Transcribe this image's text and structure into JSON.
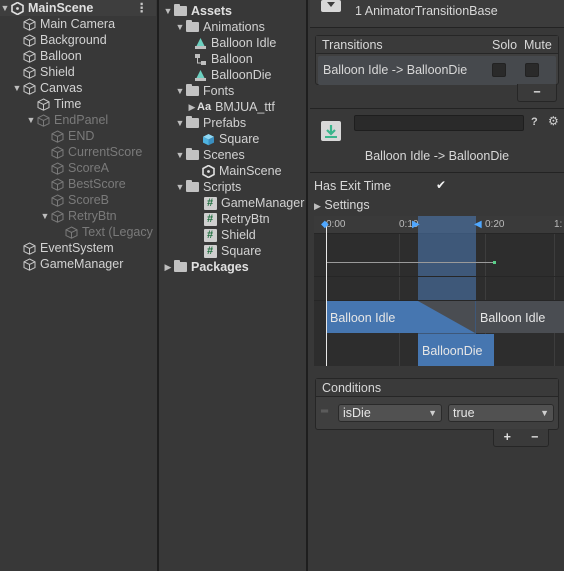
{
  "hierarchy": {
    "scene": "MainScene",
    "menu_glyph": "⋮",
    "items": [
      {
        "label": "Main Camera"
      },
      {
        "label": "Background"
      },
      {
        "label": "Balloon"
      },
      {
        "label": "Shield"
      },
      {
        "label": "Canvas"
      },
      {
        "label": "Time"
      },
      {
        "label": "EndPanel"
      },
      {
        "label": "END"
      },
      {
        "label": "CurrentScore"
      },
      {
        "label": "ScoreA"
      },
      {
        "label": "BestScore"
      },
      {
        "label": "ScoreB"
      },
      {
        "label": "RetryBtn"
      },
      {
        "label": "Text (Legacy"
      },
      {
        "label": "EventSystem"
      },
      {
        "label": "GameManager"
      }
    ]
  },
  "project": {
    "assets": "Assets",
    "animations": "Animations",
    "anim_items": [
      "Balloon Idle",
      "Balloon",
      "BalloonDie"
    ],
    "fonts": "Fonts",
    "font_item": "BMJUA_ttf",
    "font_glyph": "Aa",
    "prefabs": "Prefabs",
    "prefab_item": "Square",
    "scenes": "Scenes",
    "scene_item": "MainScene",
    "scripts": "Scripts",
    "script_items": [
      "GameManager",
      "RetryBtn",
      "Shield",
      "Square"
    ],
    "packages": "Packages"
  },
  "inspector": {
    "header_title": "1 AnimatorTransitionBase",
    "transitions_label": "Transitions",
    "solo_label": "Solo",
    "mute_label": "Mute",
    "transition_row": "Balloon Idle -> BalloonDie",
    "minus_label": "−",
    "name_field": "",
    "transition_title": "Balloon Idle -> BalloonDie",
    "has_exit_time_label": "Has Exit Time",
    "has_exit_time": true,
    "settings_label": "Settings",
    "timeline_ticks": [
      "0:00",
      "0:10",
      "0:20",
      "1:"
    ],
    "state_a": "Balloon Idle",
    "state_a2": "Balloon Idle",
    "state_b": "BalloonDie",
    "conditions_label": "Conditions",
    "condition_param": "isDie",
    "condition_value": "true",
    "plus_label": "+",
    "minus2_label": "−"
  },
  "colors": {
    "accent": "#4d7cb8",
    "icon_blue": "#4fc3e8",
    "icon_green": "#5ad08a"
  }
}
